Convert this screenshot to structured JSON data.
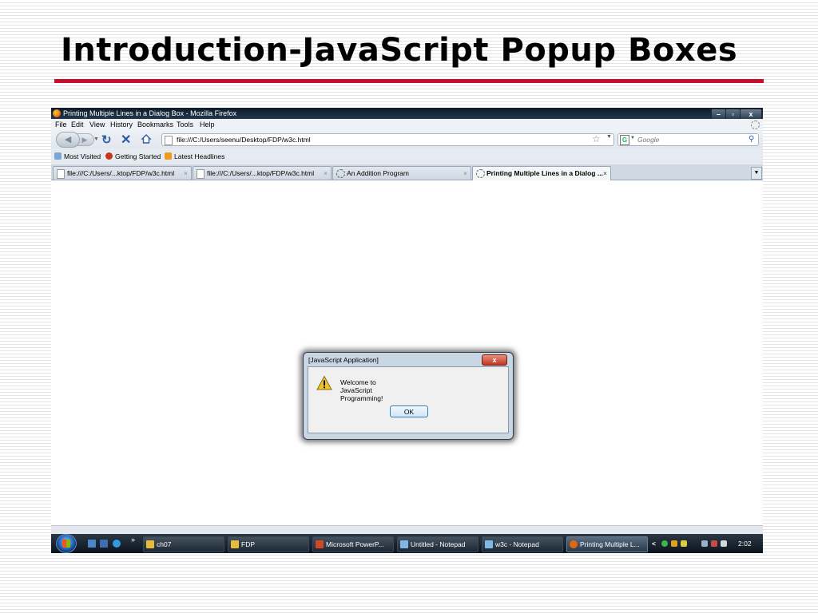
{
  "slide": {
    "title": "Introduction-JavaScript Popup Boxes",
    "accent": "#c8102e"
  },
  "browser": {
    "window_title": "Printing Multiple Lines in a Dialog Box - Mozilla Firefox",
    "window_controls": {
      "minimize": "–",
      "maximize": "▫",
      "close": "x"
    },
    "menu": [
      "File",
      "Edit",
      "View",
      "History",
      "Bookmarks",
      "Tools",
      "Help"
    ],
    "url": "file:///C:/Users/seenu/Desktop/FDP/w3c.html",
    "search_placeholder": "Google",
    "search_engine_letter": "G",
    "bookmarks": [
      "Most Visited",
      "Getting Started",
      "Latest Headlines"
    ],
    "tabs": [
      {
        "label": "file:///C:/Users/...ktop/FDP/w3c.html",
        "close": "×",
        "active": false
      },
      {
        "label": "file:///C:/Users/...ktop/FDP/w3c.html",
        "close": "×",
        "active": false
      },
      {
        "label": "An Addition Program",
        "close": "×",
        "active": false
      },
      {
        "label": "Printing Multiple Lines in a Dialog ...",
        "close": "×",
        "active": true
      }
    ]
  },
  "dialog": {
    "title": "[JavaScript Application]",
    "close_label": "x",
    "message_lines": [
      "Welcome to",
      "JavaScript",
      "Programming!"
    ],
    "ok_label": "OK",
    "icon": "warning-icon"
  },
  "taskbar": {
    "quicklaunch_more": "»",
    "tasks": [
      {
        "label": "ch07",
        "icon_color": "#e8b93a"
      },
      {
        "label": "FDP",
        "icon_color": "#e8b93a"
      },
      {
        "label": "Microsoft PowerP...",
        "icon_color": "#d24726"
      },
      {
        "label": "Untitled - Notepad",
        "icon_color": "#7fb7e6"
      },
      {
        "label": "w3c - Notepad",
        "icon_color": "#7fb7e6"
      },
      {
        "label": "Printing Multiple L...",
        "icon_color": "#e2670f"
      }
    ],
    "tray_arrow": "<",
    "clock": "2:02 AM"
  }
}
